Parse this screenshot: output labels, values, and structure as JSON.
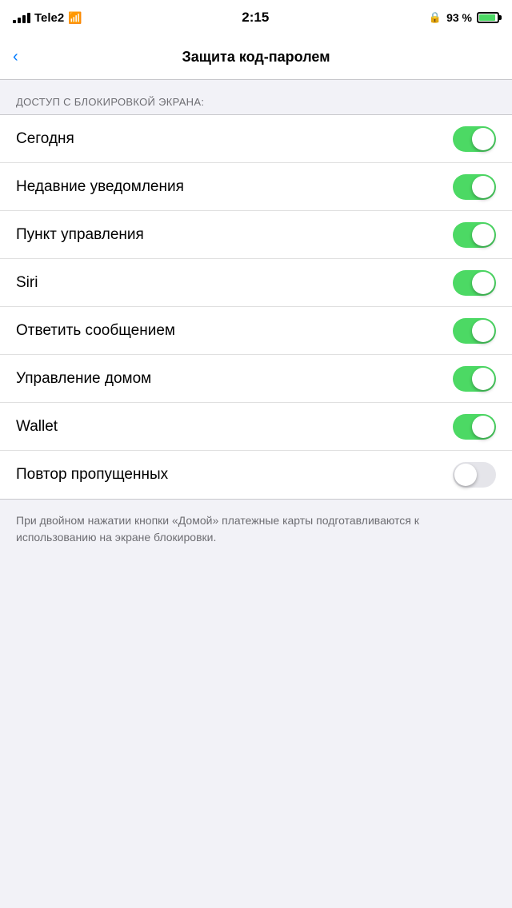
{
  "statusBar": {
    "carrier": "Tele2",
    "time": "2:15",
    "battery_percent": "93 %",
    "lock_icon": "🔒"
  },
  "navBar": {
    "title": "Защита код-паролем",
    "back_label": "‹"
  },
  "sectionHeader": "ДОСТУП С БЛОКИРОВКОЙ ЭКРАНА:",
  "rows": [
    {
      "label": "Сегодня",
      "toggled": true
    },
    {
      "label": "Недавние уведомления",
      "toggled": true
    },
    {
      "label": "Пункт управления",
      "toggled": true
    },
    {
      "label": "Siri",
      "toggled": true
    },
    {
      "label": "Ответить сообщением",
      "toggled": true
    },
    {
      "label": "Управление домом",
      "toggled": true
    },
    {
      "label": "Wallet",
      "toggled": true
    },
    {
      "label": "Повтор пропущенных",
      "toggled": false
    }
  ],
  "footerNote": "При двойном нажатии кнопки «Домой» платежные карты подготавливаются к использованию на экране блокировки."
}
